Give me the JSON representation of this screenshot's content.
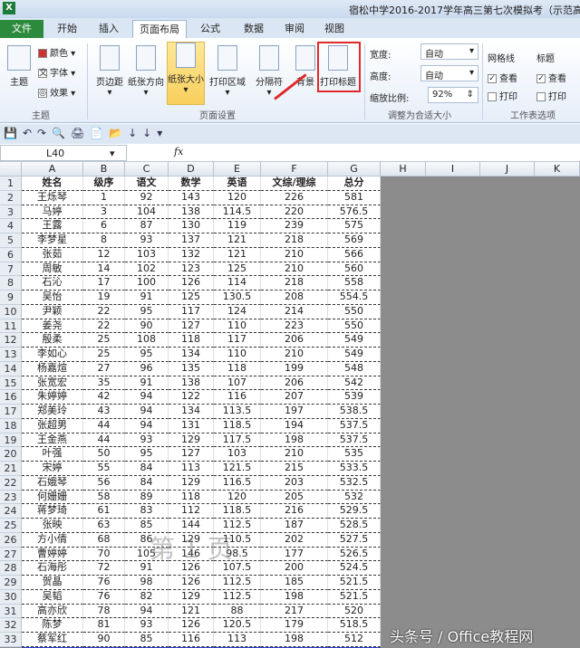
{
  "window": {
    "title": "宿松中学2016-2017学年高三第七次模拟考（示范高中"
  },
  "tabs": [
    "文件",
    "开始",
    "插入",
    "页面布局",
    "公式",
    "数据",
    "审阅",
    "视图"
  ],
  "active_tab": "页面布局",
  "ribbon": {
    "theme": {
      "label": "主题",
      "colors": "颜色",
      "fonts": "字体",
      "effects": "效果",
      "group": "主题"
    },
    "page_setup": {
      "buttons": [
        "页边距",
        "纸张方向",
        "纸张大小",
        "打印区域",
        "分隔符",
        "背景",
        "打印标题"
      ],
      "group": "页面设置"
    },
    "scale": {
      "width_label": "宽度:",
      "width_value": "自动",
      "height_label": "高度:",
      "height_value": "自动",
      "scale_label": "缩放比例:",
      "scale_value": "92%",
      "group": "调整为合适大小"
    },
    "sheet_options": {
      "gridlines": "网格线",
      "headings": "标题",
      "view": "查看",
      "print": "打印",
      "group": "工作表选项",
      "gridlines_view": true,
      "gridlines_print": false,
      "headings_view": true,
      "headings_print": false
    }
  },
  "highlight_color": "#e02a2a",
  "formula_bar": {
    "name_box": "L40",
    "fx": "fx",
    "formula": ""
  },
  "columns": [
    "A",
    "B",
    "C",
    "D",
    "E",
    "F",
    "G",
    "H",
    "I",
    "J",
    "K"
  ],
  "table": {
    "headers": [
      "姓名",
      "级序",
      "语文",
      "数学",
      "英语",
      "文综/理综",
      "总分"
    ],
    "rows": [
      [
        "王烁琴",
        "1",
        "92",
        "143",
        "120",
        "226",
        "581"
      ],
      [
        "马婷",
        "3",
        "104",
        "138",
        "114.5",
        "220",
        "576.5"
      ],
      [
        "王露",
        "6",
        "87",
        "130",
        "119",
        "239",
        "575"
      ],
      [
        "李梦星",
        "8",
        "93",
        "137",
        "121",
        "218",
        "569"
      ],
      [
        "张茹",
        "12",
        "103",
        "132",
        "121",
        "210",
        "566"
      ],
      [
        "周敏",
        "14",
        "102",
        "123",
        "125",
        "210",
        "560"
      ],
      [
        "石沁",
        "17",
        "100",
        "126",
        "114",
        "218",
        "558"
      ],
      [
        "吴怡",
        "19",
        "91",
        "125",
        "130.5",
        "208",
        "554.5"
      ],
      [
        "尹颖",
        "22",
        "95",
        "117",
        "124",
        "214",
        "550"
      ],
      [
        "姜尧",
        "22",
        "90",
        "127",
        "110",
        "223",
        "550"
      ],
      [
        "殷柔",
        "25",
        "108",
        "118",
        "117",
        "206",
        "549"
      ],
      [
        "李如心",
        "25",
        "95",
        "134",
        "110",
        "210",
        "549"
      ],
      [
        "杨嘉煊",
        "27",
        "96",
        "135",
        "118",
        "199",
        "548"
      ],
      [
        "张宽宏",
        "35",
        "91",
        "138",
        "107",
        "206",
        "542"
      ],
      [
        "朱婷婷",
        "42",
        "94",
        "122",
        "116",
        "207",
        "539"
      ],
      [
        "郑美玲",
        "43",
        "94",
        "134",
        "113.5",
        "197",
        "538.5"
      ],
      [
        "张超男",
        "44",
        "94",
        "131",
        "118.5",
        "194",
        "537.5"
      ],
      [
        "王金燕",
        "44",
        "93",
        "129",
        "117.5",
        "198",
        "537.5"
      ],
      [
        "叶强",
        "50",
        "95",
        "127",
        "103",
        "210",
        "535"
      ],
      [
        "宋婷",
        "55",
        "84",
        "113",
        "121.5",
        "215",
        "533.5"
      ],
      [
        "石娥琴",
        "56",
        "84",
        "129",
        "116.5",
        "203",
        "532.5"
      ],
      [
        "何姗姗",
        "58",
        "89",
        "118",
        "120",
        "205",
        "532"
      ],
      [
        "蒋梦琦",
        "61",
        "83",
        "112",
        "118.5",
        "216",
        "529.5"
      ],
      [
        "张映",
        "63",
        "85",
        "144",
        "112.5",
        "187",
        "528.5"
      ],
      [
        "方小倩",
        "68",
        "86",
        "129",
        "110.5",
        "202",
        "527.5"
      ],
      [
        "曹婷婷",
        "70",
        "105",
        "146",
        "98.5",
        "177",
        "526.5"
      ],
      [
        "石海彤",
        "72",
        "91",
        "126",
        "107.5",
        "200",
        "524.5"
      ],
      [
        "贺晶",
        "76",
        "98",
        "126",
        "112.5",
        "185",
        "521.5"
      ],
      [
        "吴韬",
        "76",
        "82",
        "129",
        "112.5",
        "198",
        "521.5"
      ],
      [
        "高亦欣",
        "78",
        "94",
        "121",
        "88",
        "217",
        "520"
      ],
      [
        "陈梦",
        "81",
        "93",
        "126",
        "120.5",
        "179",
        "518.5"
      ],
      [
        "蔡军红",
        "90",
        "85",
        "116",
        "113",
        "198",
        "512"
      ]
    ]
  },
  "page_watermark": "第 1 页",
  "logo": "头条号 / Office教程网"
}
